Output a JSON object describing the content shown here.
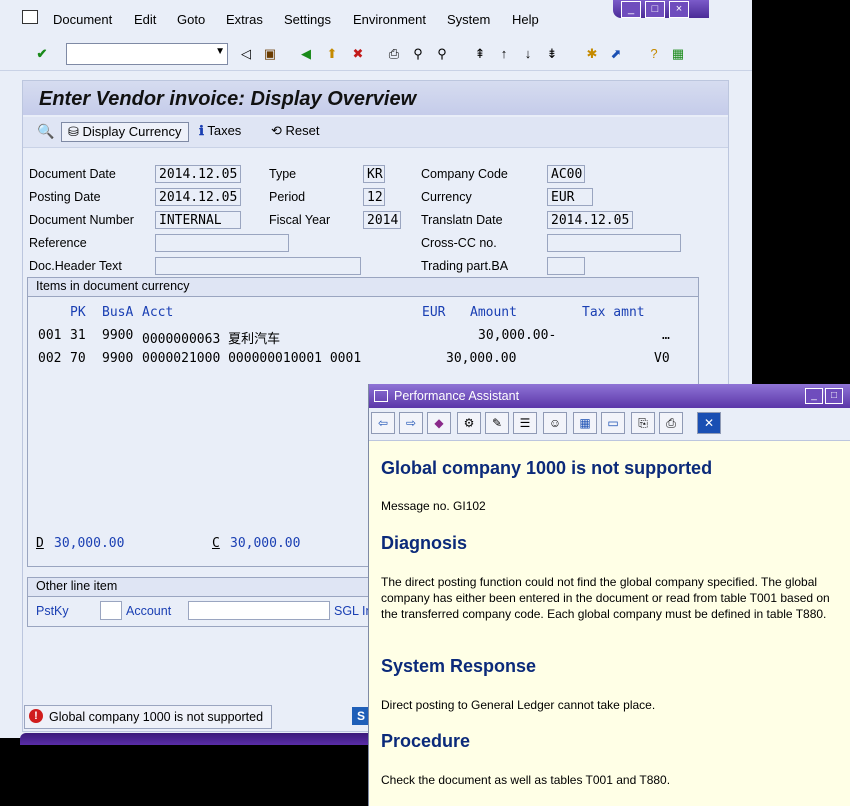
{
  "menubar": {
    "items": [
      "Document",
      "Edit",
      "Goto",
      "Extras",
      "Settings",
      "Environment",
      "System",
      "Help"
    ]
  },
  "window_title": "Enter Vendor invoice: Display Overview",
  "app_toolbar": {
    "display_currency": "Display Currency",
    "taxes": "Taxes",
    "reset": "Reset"
  },
  "header": {
    "document_date_label": "Document Date",
    "document_date": "2014.12.05",
    "type_label": "Type",
    "type": "KR",
    "company_code_label": "Company Code",
    "company_code": "AC00",
    "posting_date_label": "Posting Date",
    "posting_date": "2014.12.05",
    "period_label": "Period",
    "period": "12",
    "currency_label": "Currency",
    "currency": "EUR",
    "document_number_label": "Document Number",
    "document_number": "INTERNAL",
    "fiscal_year_label": "Fiscal Year",
    "fiscal_year": "2014",
    "translatn_date_label": "Translatn Date",
    "translatn_date": "2014.12.05",
    "reference_label": "Reference",
    "cross_cc_label": "Cross-CC no.",
    "doc_header_text_label": "Doc.Header Text",
    "trading_part_label": "Trading part.BA"
  },
  "items": {
    "title": "Items in document currency",
    "columns": {
      "pk": "PK",
      "busa": "BusA",
      "acct": "Acct",
      "eur": "EUR",
      "amount": "Amount",
      "tax": "Tax amnt"
    },
    "rows": [
      {
        "line": "001",
        "pk": "31",
        "busa": "9900",
        "acct": "0000000063 夏利汽车",
        "amount": "30,000.00-",
        "tax": "…"
      },
      {
        "line": "002",
        "pk": "70",
        "busa": "9900",
        "acct": "0000021000 000000010001 0001",
        "amount": "30,000.00",
        "tax": "V0"
      }
    ],
    "debit_label": "D",
    "debit_total": "30,000.00",
    "credit_label": "C",
    "credit_total": "30,000.00"
  },
  "other": {
    "title": "Other line item",
    "pstky_label": "PstKy",
    "account_label": "Account",
    "sgl_label": "SGL In"
  },
  "status": {
    "message": "Global company 1000 is not supported"
  },
  "pa": {
    "title": "Performance Assistant",
    "heading": "Global company 1000 is not supported",
    "message_no": "Message no. GI102",
    "diagnosis_h": "Diagnosis",
    "diagnosis_text": "The direct posting function could not find the global company specified. The global company has either been entered in the document or read from table T001 based on the transferred company code.  Each global company must be defined in table T880.",
    "system_response_h": "System Response",
    "system_response_text": "Direct posting to General Ledger cannot take place.",
    "procedure_h": "Procedure",
    "procedure_text": "Check the document as well as tables T001 and T880."
  }
}
